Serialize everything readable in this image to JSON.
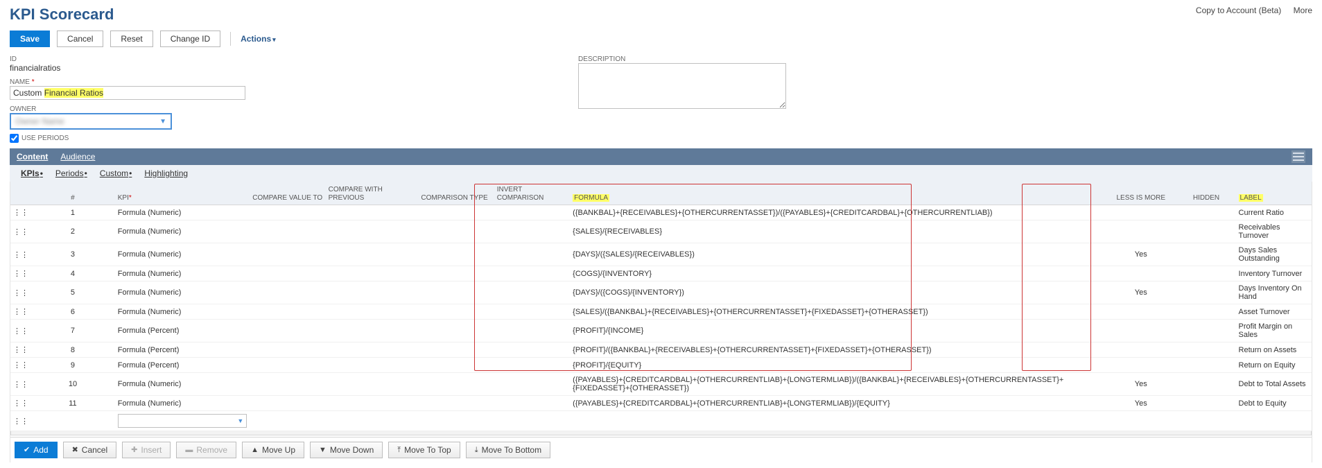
{
  "header": {
    "title": "KPI Scorecard",
    "copy_link": "Copy to Account (Beta)",
    "more_link": "More"
  },
  "buttons": {
    "save": "Save",
    "cancel": "Cancel",
    "reset": "Reset",
    "change_id": "Change ID",
    "actions": "Actions"
  },
  "form": {
    "id_label": "ID",
    "id_value": "financialratios",
    "name_label": "NAME",
    "name_prefix": "Custom ",
    "name_highlight": "Financial Ratios",
    "owner_label": "OWNER",
    "owner_value": "Owner Name",
    "use_periods": "USE PERIODS",
    "desc_label": "DESCRIPTION"
  },
  "tabs": {
    "content": "Content",
    "audience": "Audience"
  },
  "subtabs": {
    "kpis": "KPIs",
    "periods": "Periods",
    "custom": "Custom",
    "highlighting": "Highlighting"
  },
  "grid": {
    "headers": {
      "num": "#",
      "kpi": "KPI",
      "compare_value_to": "COMPARE VALUE TO",
      "compare_with_previous": "COMPARE WITH PREVIOUS",
      "comparison_type": "COMPARISON TYPE",
      "invert_comparison": "INVERT COMPARISON",
      "formula": "FORMULA",
      "less_is_more": "LESS IS MORE",
      "hidden": "HIDDEN",
      "label": "LABEL"
    },
    "rows": [
      {
        "n": "1",
        "kpi": "Formula (Numeric)",
        "formula": "({BANKBAL}+{RECEIVABLES}+{OTHERCURRENTASSET})/({PAYABLES}+{CREDITCARDBAL}+{OTHERCURRENTLIAB})",
        "less": "",
        "label": "Current Ratio"
      },
      {
        "n": "2",
        "kpi": "Formula (Numeric)",
        "formula": "{SALES}/{RECEIVABLES}",
        "less": "",
        "label": "Receivables Turnover"
      },
      {
        "n": "3",
        "kpi": "Formula (Numeric)",
        "formula": "{DAYS}/({SALES}/{RECEIVABLES})",
        "less": "Yes",
        "label": "Days Sales Outstanding"
      },
      {
        "n": "4",
        "kpi": "Formula (Numeric)",
        "formula": "{COGS}/{INVENTORY}",
        "less": "",
        "label": "Inventory Turnover"
      },
      {
        "n": "5",
        "kpi": "Formula (Numeric)",
        "formula": "{DAYS}/({COGS}/{INVENTORY})",
        "less": "Yes",
        "label": "Days Inventory On Hand"
      },
      {
        "n": "6",
        "kpi": "Formula (Numeric)",
        "formula": "{SALES}/({BANKBAL}+{RECEIVABLES}+{OTHERCURRENTASSET}+{FIXEDASSET}+{OTHERASSET})",
        "less": "",
        "label": "Asset Turnover"
      },
      {
        "n": "7",
        "kpi": "Formula (Percent)",
        "formula": "{PROFIT}/{INCOME}",
        "less": "",
        "label": "Profit Margin on Sales"
      },
      {
        "n": "8",
        "kpi": "Formula (Percent)",
        "formula": "{PROFIT}/({BANKBAL}+{RECEIVABLES}+{OTHERCURRENTASSET}+{FIXEDASSET}+{OTHERASSET})",
        "less": "",
        "label": "Return on Assets"
      },
      {
        "n": "9",
        "kpi": "Formula (Percent)",
        "formula": "{PROFIT}/{EQUITY}",
        "less": "",
        "label": "Return on Equity"
      },
      {
        "n": "10",
        "kpi": "Formula (Numeric)",
        "formula": "({PAYABLES}+{CREDITCARDBAL}+{OTHERCURRENTLIAB}+{LONGTERMLIAB})/({BANKBAL}+{RECEIVABLES}+{OTHERCURRENTASSET}+{FIXEDASSET}+{OTHERASSET})",
        "less": "Yes",
        "label": "Debt to Total Assets"
      },
      {
        "n": "11",
        "kpi": "Formula (Numeric)",
        "formula": "({PAYABLES}+{CREDITCARDBAL}+{OTHERCURRENTLIAB}+{LONGTERMLIAB})/{EQUITY}",
        "less": "Yes",
        "label": "Debt to Equity"
      }
    ]
  },
  "footer": {
    "add": "Add",
    "cancel": "Cancel",
    "insert": "Insert",
    "remove": "Remove",
    "move_up": "Move Up",
    "move_down": "Move Down",
    "move_top": "Move To Top",
    "move_bottom": "Move To Bottom"
  }
}
